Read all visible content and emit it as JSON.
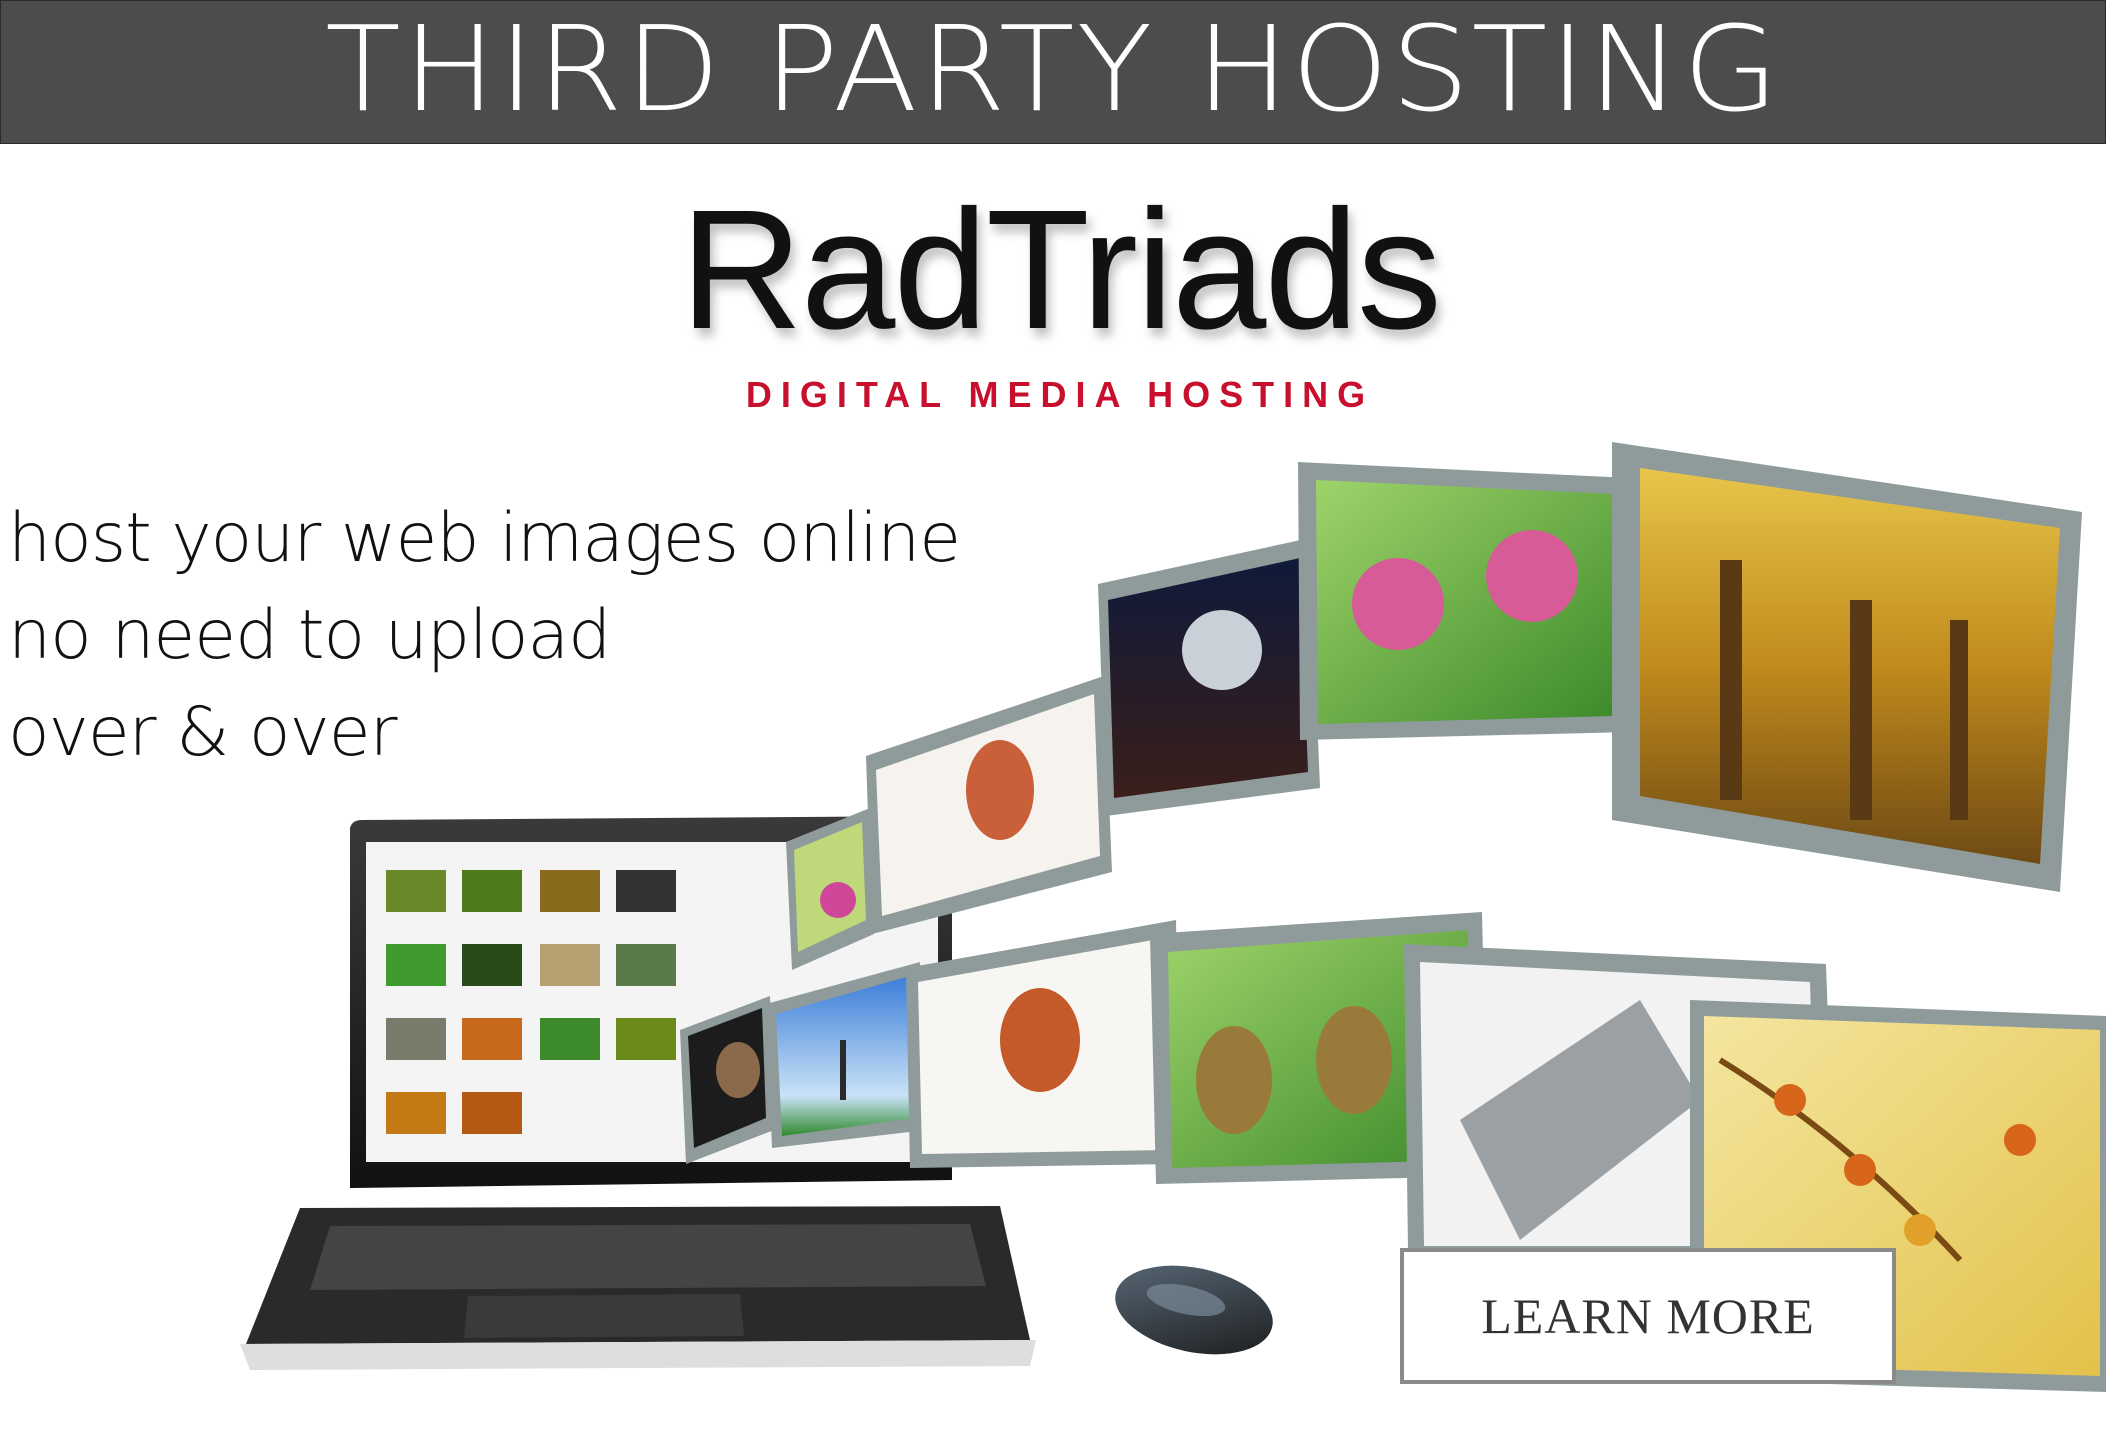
{
  "header": {
    "title": "THIRD PARTY HOSTING"
  },
  "logo": {
    "wordmark": "RadTriads",
    "tagline": "DIGITAL MEDIA HOSTING"
  },
  "copy": {
    "lines": [
      "host your web images online",
      "no need to upload",
      "over & over"
    ]
  },
  "cta": {
    "label": "LEARN MORE"
  },
  "colors": {
    "header_bg": "#4c4c4c",
    "tagline": "#c8102e",
    "film_frame": "#8f9b9b"
  }
}
